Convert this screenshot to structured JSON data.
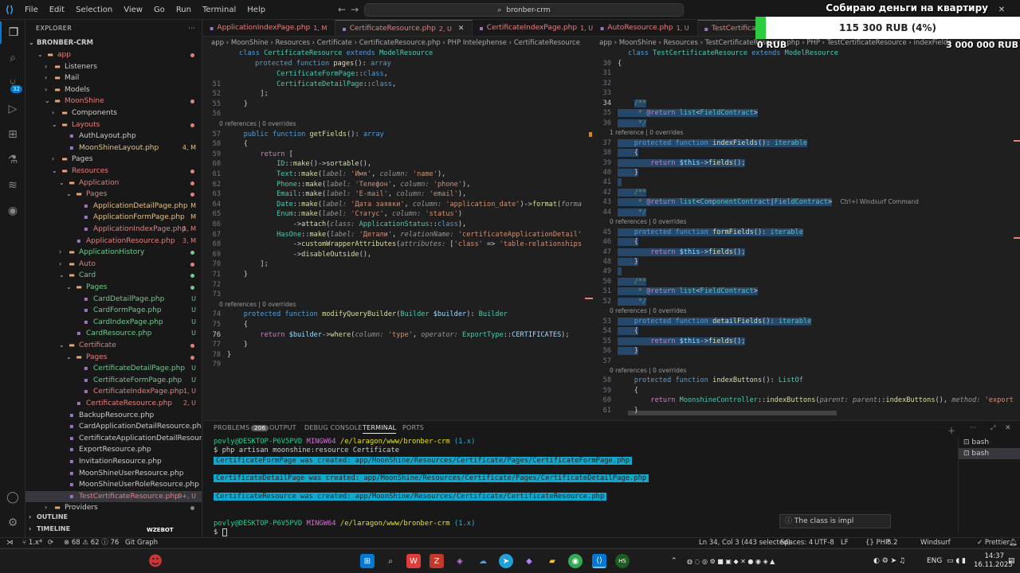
{
  "titlebar": {
    "menu": [
      "File",
      "Edit",
      "Selection",
      "View",
      "Go",
      "Run",
      "Terminal",
      "Help"
    ],
    "search": "bronber-crm"
  },
  "activity": {
    "source_control_badge": "32"
  },
  "explorer": {
    "header": "EXPLORER",
    "project": "BRONBER-CRM",
    "rows": [
      {
        "label": "app",
        "depth": 1,
        "type": "folder-open",
        "color": "c-red",
        "dot": "#e2807f"
      },
      {
        "label": "Listeners",
        "depth": 2,
        "type": "folder",
        "color": "c-white"
      },
      {
        "label": "Mail",
        "depth": 2,
        "type": "folder",
        "color": "c-white"
      },
      {
        "label": "Models",
        "depth": 2,
        "type": "folder",
        "color": "c-white"
      },
      {
        "label": "MoonShine",
        "depth": 2,
        "type": "folder-open",
        "color": "c-red",
        "dot": "#e2807f"
      },
      {
        "label": "Components",
        "depth": 3,
        "type": "folder",
        "color": "c-white"
      },
      {
        "label": "Layouts",
        "depth": 3,
        "type": "folder-open",
        "color": "c-red",
        "dot": "#e2807f"
      },
      {
        "label": "AuthLayout.php",
        "depth": 4,
        "type": "php",
        "color": "c-white"
      },
      {
        "label": "MoonShineLayout.php",
        "depth": 4,
        "type": "php",
        "color": "c-yellow",
        "stat": "4, M"
      },
      {
        "label": "Pages",
        "depth": 3,
        "type": "folder",
        "color": "c-white"
      },
      {
        "label": "Resources",
        "depth": 3,
        "type": "folder-open",
        "color": "c-red",
        "dot": "#e2807f"
      },
      {
        "label": "Application",
        "depth": 4,
        "type": "folder-open",
        "color": "c-red",
        "dot": "#e2807f"
      },
      {
        "label": "Pages",
        "depth": 5,
        "type": "folder-open",
        "color": "c-red",
        "dot": "#e2807f"
      },
      {
        "label": "ApplicationDetailPage.php",
        "depth": 6,
        "type": "php",
        "color": "c-yellow",
        "stat": "M"
      },
      {
        "label": "ApplicationFormPage.php",
        "depth": 6,
        "type": "php",
        "color": "c-yellow",
        "stat": "M"
      },
      {
        "label": "ApplicationIndexPage.php",
        "depth": 6,
        "type": "php",
        "color": "c-red",
        "stat": "1, M"
      },
      {
        "label": "ApplicationResource.php",
        "depth": 5,
        "type": "php",
        "color": "c-red",
        "stat": "3, M"
      },
      {
        "label": "ApplicationHistory",
        "depth": 4,
        "type": "folder",
        "color": "c-green",
        "dot": "#73c991"
      },
      {
        "label": "Auto",
        "depth": 4,
        "type": "folder",
        "color": "c-red",
        "dot": "#e2807f"
      },
      {
        "label": "Card",
        "depth": 4,
        "type": "folder-open",
        "color": "c-green",
        "dot": "#73c991"
      },
      {
        "label": "Pages",
        "depth": 5,
        "type": "folder-open",
        "color": "c-green",
        "dot": "#73c991"
      },
      {
        "label": "CardDetailPage.php",
        "depth": 6,
        "type": "php",
        "color": "c-green",
        "stat": "U"
      },
      {
        "label": "CardFormPage.php",
        "depth": 6,
        "type": "php",
        "color": "c-green",
        "stat": "U"
      },
      {
        "label": "CardIndexPage.php",
        "depth": 6,
        "type": "php",
        "color": "c-green",
        "stat": "U"
      },
      {
        "label": "CardResource.php",
        "depth": 5,
        "type": "php",
        "color": "c-green",
        "stat": "U"
      },
      {
        "label": "Certificate",
        "depth": 4,
        "type": "folder-open",
        "color": "c-red",
        "dot": "#e2807f"
      },
      {
        "label": "Pages",
        "depth": 5,
        "type": "folder-open",
        "color": "c-red",
        "dot": "#e2807f"
      },
      {
        "label": "CertificateDetailPage.php",
        "depth": 6,
        "type": "php",
        "color": "c-green",
        "stat": "U"
      },
      {
        "label": "CertificateFormPage.php",
        "depth": 6,
        "type": "php",
        "color": "c-green",
        "stat": "U"
      },
      {
        "label": "CertificateIndexPage.php",
        "depth": 6,
        "type": "php",
        "color": "c-red",
        "stat": "1, U"
      },
      {
        "label": "CertificateResource.php",
        "depth": 5,
        "type": "php",
        "color": "c-red",
        "stat": "2, U"
      },
      {
        "label": "BackupResource.php",
        "depth": 4,
        "type": "php",
        "color": "c-white"
      },
      {
        "label": "CardApplicationDetailResource.php",
        "depth": 4,
        "type": "php",
        "color": "c-white"
      },
      {
        "label": "CertificateApplicationDetailResource.php",
        "depth": 4,
        "type": "php",
        "color": "c-white"
      },
      {
        "label": "ExportResource.php",
        "depth": 4,
        "type": "php",
        "color": "c-white"
      },
      {
        "label": "InvitationResource.php",
        "depth": 4,
        "type": "php",
        "color": "c-white"
      },
      {
        "label": "MoonShineUserResource.php",
        "depth": 4,
        "type": "php",
        "color": "c-white"
      },
      {
        "label": "MoonShineUserRoleResource.php",
        "depth": 4,
        "type": "php",
        "color": "c-white"
      },
      {
        "label": "TestCertificateResource.php",
        "depth": 4,
        "type": "php",
        "color": "c-red",
        "stat": "9+, U",
        "selected": true
      },
      {
        "label": "Providers",
        "depth": 2,
        "type": "folder",
        "color": "c-white",
        "dot": "#888888"
      }
    ],
    "outline": "OUTLINE",
    "timeline": "TIMELINE"
  },
  "left_tabs": [
    {
      "name": "ApplicationIndexPage.php",
      "status": "1, M",
      "color": "#e2807f",
      "active": false
    },
    {
      "name": "CertificateResource.php",
      "status": "2, U",
      "color": "#e2807f",
      "active": true
    },
    {
      "name": "CertificateIndexPage.php",
      "status": "1, U",
      "color": "#e2807f",
      "active": false
    }
  ],
  "right_tabs": [
    {
      "name": "AutoResource.php",
      "status": "1, U",
      "color": "#e2807f",
      "active": false
    },
    {
      "name": "TestCertificateResource.php",
      "status": "",
      "color": "#e2807f",
      "active": true
    }
  ],
  "left_breadcrumb": [
    "app",
    "MoonShine",
    "Resources",
    "Certificate",
    "CertificateResource.php",
    "PHP Intelephense",
    "CertificateResource"
  ],
  "right_breadcrumb": [
    "app",
    "MoonShine",
    "Resources",
    "TestCertificateResource.php",
    "PHP",
    "TestCertificateResource",
    "indexFields"
  ],
  "left_header": "class CertificateResource extends ModelResource",
  "left_pages_line": "protected function pages(): array",
  "right_header": "class TestCertificateResource extends ModelResource",
  "left_code": [
    {
      "n": "",
      "html": "            <span class='cls'>CertificateFormPage</span>::<span class='kw'>class</span>,"
    },
    {
      "n": "51",
      "html": "            <span class='cls'>CertificateDetailPage</span>::<span class='kw'>class</span>,"
    },
    {
      "n": "52",
      "html": "        ];"
    },
    {
      "n": "55",
      "html": "    }"
    },
    {
      "n": "56",
      "html": ""
    },
    {
      "n": "",
      "ref": "0 references | 0 overrides"
    },
    {
      "n": "57",
      "html": "    <span class='kw'>public</span> <span class='kw'>function</span> <span class='fn'>getFields</span>(): <span class='kw'>array</span>"
    },
    {
      "n": "58",
      "html": "    {"
    },
    {
      "n": "59",
      "html": "        <span class='kw2'>return</span> ["
    },
    {
      "n": "60",
      "html": "            <span class='cls'>ID</span>::<span class='fn'>make</span>()-&gt;<span class='fn'>sortable</span>(),"
    },
    {
      "n": "61",
      "html": "            <span class='cls'>Text</span>::<span class='fn'>make</span>(<span class='hint'>label:</span> <span class='str'>'Имя'</span>, <span class='hint'>column:</span> <span class='str'>'name'</span>),"
    },
    {
      "n": "62",
      "html": "            <span class='cls'>Phone</span>::<span class='fn'>make</span>(<span class='hint'>label:</span> <span class='str'>'Телефон'</span>, <span class='hint'>column:</span> <span class='str'>'phone'</span>),"
    },
    {
      "n": "63",
      "html": "            <span class='cls'>Email</span>::<span class='fn'>make</span>(<span class='hint'>label:</span> <span class='str'>'E-mail'</span>, <span class='hint'>column:</span> <span class='str'>'email'</span>),"
    },
    {
      "n": "64",
      "html": "            <span class='cls'>Date</span>::<span class='fn'>make</span>(<span class='hint'>label:</span> <span class='str'>'Дата заявки'</span>, <span class='hint'>column:</span> <span class='str'>'application_date'</span>)-&gt;<span class='fn'>format</span>(<span class='hint'>forma</span>"
    },
    {
      "n": "65",
      "html": "            <span class='cls'>Enum</span>::<span class='fn'>make</span>(<span class='hint'>label:</span> <span class='str'>'Статус'</span>, <span class='hint'>column:</span> <span class='str'>'status'</span>)"
    },
    {
      "n": "66",
      "html": "                -&gt;<span class='fn'>attach</span>(<span class='hint'>class:</span> <span class='cls'>ApplicationStatus</span>::<span class='kw'>class</span>),"
    },
    {
      "n": "67",
      "html": "            <span class='cls'>HasOne</span>::<span class='fn'>make</span>(<span class='hint'>label:</span> <span class='str'>'Детали'</span>, <span class='hint'>relationName:</span> <span class='str'>'certificateApplicationDetail'</span>"
    },
    {
      "n": "68",
      "html": "                -&gt;<span class='fn'>customWrapperAttributes</span>(<span class='hint'>attributes:</span> [<span class='str'>'class'</span> =&gt; <span class='str'>'table-relationships</span>"
    },
    {
      "n": "69",
      "html": "                -&gt;<span class='fn'>disableOutside</span>(),"
    },
    {
      "n": "70",
      "html": "        ];"
    },
    {
      "n": "71",
      "html": "    }"
    },
    {
      "n": "72",
      "html": ""
    },
    {
      "n": "73",
      "html": ""
    },
    {
      "n": "",
      "ref": "0 references | 0 overrides"
    },
    {
      "n": "74",
      "html": "    <span class='kw'>protected</span> <span class='kw'>function</span> <span class='fn'>modifyQueryBuilder</span>(<span class='cls'>Builder</span> <span class='var'>$builder</span>): <span class='cls'>Builder</span>"
    },
    {
      "n": "75",
      "html": "    {"
    },
    {
      "n": "76",
      "html": "        <span class='kw2'>return</span> <span class='var'>$builder</span>-&gt;<span class='fn'>where</span>(<span class='hint'>column:</span> <span class='str'>'type'</span>, <span class='hint'>operator:</span> <span class='cls'>ExportType</span>::<span class='var'>CERTIFICATES</span>);",
      "cur": true
    },
    {
      "n": "77",
      "html": "    }"
    },
    {
      "n": "78",
      "html": "}"
    },
    {
      "n": "79",
      "html": ""
    }
  ],
  "right_code": [
    {
      "n": "30",
      "html": "{"
    },
    {
      "n": "31",
      "html": ""
    },
    {
      "n": "32",
      "html": ""
    },
    {
      "n": "33",
      "html": ""
    },
    {
      "n": "34",
      "html": "    <span class='sel'><span class='cmt'>/**</span></span>",
      "cur": true
    },
    {
      "n": "35",
      "html": "<span class='sel'><span class='cmt'>     * </span><span class='kw2'>@return</span> <span class='cls'>list</span>&lt;<span class='cls'>FieldContract</span>&gt;</span>"
    },
    {
      "n": "36",
      "html": "<span class='sel'><span class='cmt'>     */</span></span>"
    },
    {
      "n": "",
      "ref": "1 reference | 0 overrides"
    },
    {
      "n": "37",
      "html": "<span class='sel'>    <span class='kw'>protected</span> <span class='kw'>function</span> <span class='fn'>indexFields</span>(): <span class='cls'>iterable</span></span>"
    },
    {
      "n": "38",
      "html": "<span class='sel'>    {</span>"
    },
    {
      "n": "39",
      "html": "<span class='sel'>        <span class='kw2'>return</span> <span class='var'>$this</span>-&gt;<span class='fn'>fields</span>();</span>"
    },
    {
      "n": "40",
      "html": "<span class='sel'>    }</span>"
    },
    {
      "n": "41",
      "html": "<span class='sel'> </span>"
    },
    {
      "n": "42",
      "html": "<span class='sel'>    <span class='cmt'>/**</span></span>"
    },
    {
      "n": "43",
      "html": "<span class='sel'><span class='cmt'>     * </span><span class='kw2'>@return</span> <span class='cls'>list</span>&lt;<span class='cls'>ComponentContract</span>|<span class='cls'>FieldContract</span>&gt;</span>  <span class='ref'>Ctrl+I Windsurf Command</span>"
    },
    {
      "n": "44",
      "html": "<span class='sel'><span class='cmt'>     */</span></span>"
    },
    {
      "n": "",
      "ref": "0 references | 0 overrides"
    },
    {
      "n": "45",
      "html": "<span class='sel'>    <span class='kw'>protected</span> <span class='kw'>function</span> <span class='fn'>formFields</span>(): <span class='cls'>iterable</span></span>"
    },
    {
      "n": "46",
      "html": "<span class='sel'>    {</span>"
    },
    {
      "n": "47",
      "html": "<span class='sel'>        <span class='kw2'>return</span> <span class='var'>$this</span>-&gt;<span class='fn'>fields</span>();</span>"
    },
    {
      "n": "48",
      "html": "<span class='sel'>    }</span>"
    },
    {
      "n": "49",
      "html": "<span class='sel'> </span>"
    },
    {
      "n": "50",
      "html": "<span class='sel'>    <span class='cmt'>/**</span></span>"
    },
    {
      "n": "51",
      "html": "<span class='sel'><span class='cmt'>     * </span><span class='kw2'>@return</span> <span class='cls'>list</span>&lt;<span class='cls'>FieldContract</span>&gt;</span>"
    },
    {
      "n": "52",
      "html": "<span class='sel'><span class='cmt'>     */</span></span>"
    },
    {
      "n": "",
      "ref": "0 references | 0 overrides"
    },
    {
      "n": "53",
      "html": "<span class='sel'>    <span class='kw'>protected</span> <span class='kw'>function</span> <span class='fn'>detailFields</span>(): <span class='cls'>iterable</span></span>"
    },
    {
      "n": "54",
      "html": "<span class='sel'>    {</span>"
    },
    {
      "n": "55",
      "html": "<span class='sel'>        <span class='kw2'>return</span> <span class='var'>$this</span>-&gt;<span class='fn'>fields</span>();</span>"
    },
    {
      "n": "56",
      "html": "<span class='sel'>    }</span>"
    },
    {
      "n": "57",
      "html": ""
    },
    {
      "n": "",
      "ref": "0 references | 0 overrides"
    },
    {
      "n": "58",
      "html": "    <span class='kw'>protected</span> <span class='kw'>function</span> <span class='fn'>indexButtons</span>(): <span class='cls'>ListOf</span>"
    },
    {
      "n": "59",
      "html": "    {"
    },
    {
      "n": "60",
      "html": "        <span class='kw2'>return</span> <span class='cls'>MoonshineController</span>::<span class='fn'>indexButtons</span>(<span class='hint'>parent:</span> <span class='hint'>parent</span>::<span class='fn'>indexButtons</span>(), <span class='hint'>method:</span> <span class='str'>'export</span>"
    },
    {
      "n": "61",
      "html": "    }"
    },
    {
      "n": "62",
      "html": ""
    }
  ],
  "panel": {
    "tabs": [
      "PROBLEMS",
      "OUTPUT",
      "DEBUG CONSOLE",
      "TERMINAL",
      "PORTS"
    ],
    "problems_count": "206",
    "prompt_user": "povly@DESKTOP-P6V5PVD",
    "prompt_shell": "MINGW64",
    "prompt_path": "/e/laragon/www/bronber-crm",
    "prompt_branch": "(1.x)",
    "command": "$ php artisan moonshine:resource Certificate",
    "messages": [
      "CertificateFormPage was created: app/MoonShine/Resources/Certificate/Pages/CertificateFormPage.php",
      "CertificateDetailPage was created: app/MoonShine/Resources/Certificate/Pages/CertificateDetailPage.php",
      "CertificateResource was created: app/MoonShine/Resources/Certificate/CertificateResource.php"
    ],
    "prompt_end": "$ ",
    "terminals": [
      "bash",
      "bash"
    ]
  },
  "toast": "The class is impl",
  "statusbar": {
    "remote": "1.x*",
    "errors": "68",
    "warnings": "62",
    "info": "76",
    "git_graph": "Git Graph",
    "position": "Ln 34, Col 3 (443 selected)",
    "spaces": "Spaces: 4",
    "encoding": "UTF-8",
    "eol": "LF",
    "language": "PHP",
    "php_version": "8.2",
    "windsurf": "Windsurf",
    "prettier": "Prettier",
    "logo_text": "WZEBOT"
  },
  "taskbar": {
    "lang": "ENG",
    "time": "14:37",
    "date": "16.11.2025"
  },
  "donation": {
    "title": "Собираю деньги на квартиру",
    "amount": "115 300 RUB (4%)",
    "progress": 0.04,
    "min": "0 RUB",
    "max": "3 000 000 RUB"
  },
  "colors": {
    "accent": "#0078d4",
    "progress": "#2ecc40"
  }
}
